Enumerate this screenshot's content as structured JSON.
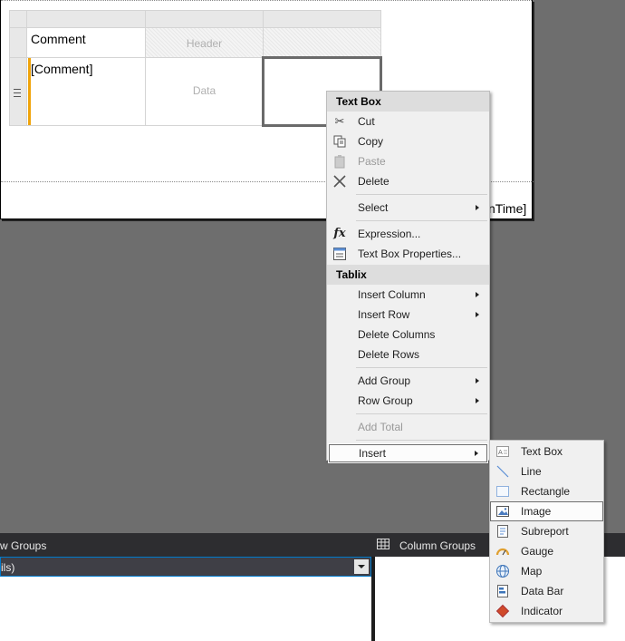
{
  "tablix": {
    "header_row": {
      "col1": "Comment",
      "col2_placeholder": "Header"
    },
    "data_row": {
      "col1": "[Comment]",
      "col2_placeholder": "Data"
    },
    "row_handle_icon": "grip-lines-icon",
    "footer_text": "nTime]"
  },
  "context_menu": {
    "textbox_header": "Text Box",
    "textbox_items": [
      {
        "label": "Cut",
        "icon": "scissors-icon",
        "disabled": false
      },
      {
        "label": "Copy",
        "icon": "copy-icon",
        "disabled": false
      },
      {
        "label": "Paste",
        "icon": "clipboard-icon",
        "disabled": true
      },
      {
        "label": "Delete",
        "icon": "x-icon",
        "disabled": false
      }
    ],
    "select_label": "Select",
    "expression_label": "Expression...",
    "properties_label": "Text Box Properties...",
    "tablix_header": "Tablix",
    "tablix_items": {
      "insert_column": "Insert Column",
      "insert_row": "Insert Row",
      "delete_columns": "Delete Columns",
      "delete_rows": "Delete Rows",
      "add_group": "Add Group",
      "row_group": "Row Group",
      "add_total": "Add Total",
      "insert": "Insert"
    }
  },
  "insert_submenu": {
    "items": [
      {
        "label": "Text Box",
        "icon": "textbox-icon"
      },
      {
        "label": "Line",
        "icon": "line-icon"
      },
      {
        "label": "Rectangle",
        "icon": "rectangle-icon"
      },
      {
        "label": "Image",
        "icon": "image-icon",
        "selected": true
      },
      {
        "label": "Subreport",
        "icon": "subreport-icon"
      },
      {
        "label": "Gauge",
        "icon": "gauge-icon"
      },
      {
        "label": "Map",
        "icon": "globe-icon"
      },
      {
        "label": "Data Bar",
        "icon": "databar-icon"
      },
      {
        "label": "Indicator",
        "icon": "diamond-icon"
      }
    ]
  },
  "groups": {
    "row_groups_label": "w Groups",
    "row_group_value": "ils)",
    "column_groups_label": "Column Groups"
  },
  "colors": {
    "accent": "#007acc",
    "selection_bar": "#f0a30a",
    "dark_panel": "#2d2d30",
    "workspace": "#6e6e6e"
  }
}
